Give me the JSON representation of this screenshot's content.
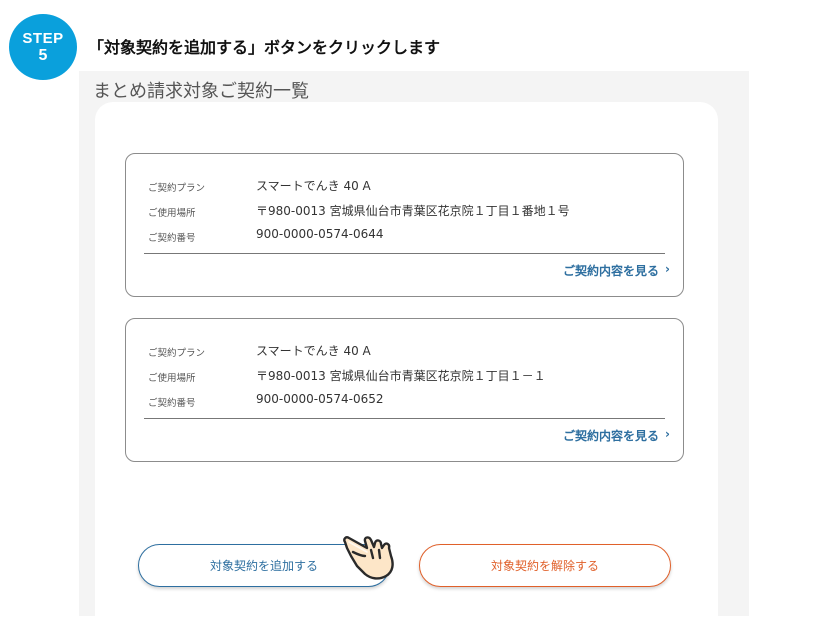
{
  "step": {
    "label": "STEP",
    "number": "5",
    "color": "#0aa0dc"
  },
  "instruction": "「対象契約を追加する」ボタンをクリックします",
  "section_title": "まとめ請求対象ご契約一覧",
  "contracts": [
    {
      "plan_label": "ご契約プラン",
      "plan_value": "スマートでんき 40 A",
      "place_label": "ご使用場所",
      "place_value": "〒980-0013 宮城県仙台市青葉区花京院１丁目１番地１号",
      "number_label": "ご契約番号",
      "number_value": "900-0000-0574-0644",
      "detail_link": "ご契約内容を見る"
    },
    {
      "plan_label": "ご契約プラン",
      "plan_value": "スマートでんき 40 A",
      "place_label": "ご使用場所",
      "place_value": "〒980-0013 宮城県仙台市青葉区花京院１丁目１－１",
      "number_label": "ご契約番号",
      "number_value": "900-0000-0574-0652",
      "detail_link": "ご契約内容を見る"
    }
  ],
  "buttons": {
    "add": "対象契約を追加する",
    "remove": "対象契約を解除する"
  },
  "colors": {
    "accent": "#2e6fa0",
    "remove": "#e0602a",
    "panel": "#f4f4f4"
  },
  "icons": {
    "pointer": "pointing-hand-icon",
    "chevron": "chevron-right-icon"
  }
}
